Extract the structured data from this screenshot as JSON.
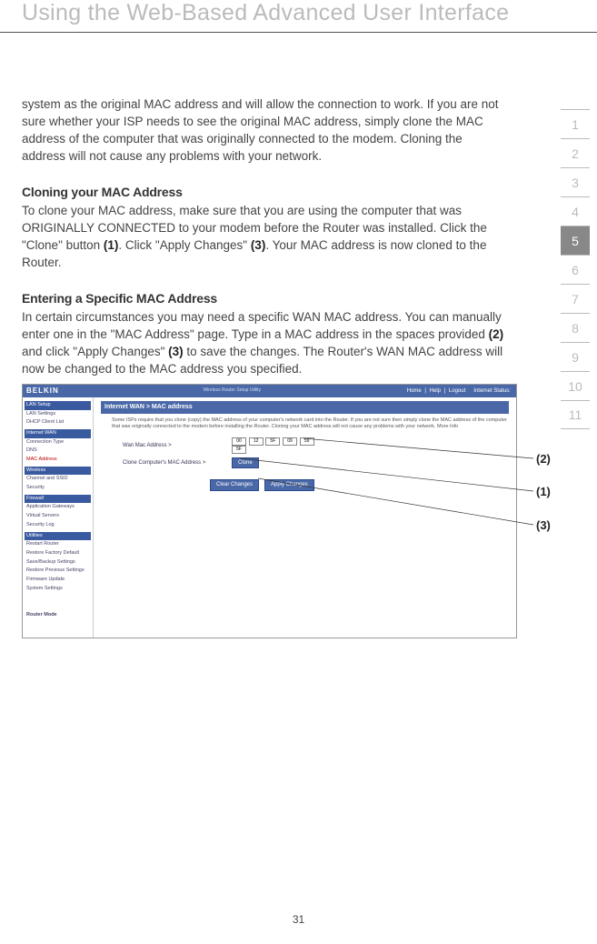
{
  "header": {
    "title": "Using the Web-Based Advanced User Interface"
  },
  "body": {
    "intro": "system as the original MAC address and will allow the connection to work. If you are not sure whether your ISP needs to see the original MAC address, simply clone the MAC address of the computer that was originally connected to the modem. Cloning the address will not cause any problems with your network.",
    "cloning_head": "Cloning your MAC Address",
    "cloning_p1a": "To clone your MAC address, make sure that you are using the computer that was ORIGINALLY CONNECTED to your modem before the Router was installed. Click the \"Clone\" button ",
    "ref1": "(1)",
    "cloning_p1b": ". Click \"Apply Changes\" ",
    "ref3a": "(3)",
    "cloning_p1c": ". Your MAC address is now cloned to the Router.",
    "entering_head": "Entering a Specific MAC Address",
    "entering_p1a": "In certain circumstances you may need a specific WAN MAC address. You can manually enter one in the \"MAC Address\" page. Type in a MAC address in the spaces provided ",
    "ref2": "(2)",
    "entering_p1b": " and click \"Apply Changes\" ",
    "ref3b": "(3)",
    "entering_p1c": " to save the changes. The Router's WAN MAC address will now be changed to the MAC address you specified."
  },
  "tabs": [
    "1",
    "2",
    "3",
    "4",
    "5",
    "6",
    "7",
    "8",
    "9",
    "10",
    "11"
  ],
  "active_tab": "5",
  "screenshot": {
    "brand": "BELKIN",
    "subtitle": "Wireless Router Setup Utility",
    "toplinks": [
      "Home",
      "Help",
      "Logout",
      "Internet Status:"
    ],
    "breadcrumb": "Internet WAN > MAC address",
    "desc": "Some ISPs require that you clone (copy) the MAC address of your computer's network card into the Router. If you are not sure then simply clone the MAC address of the computer that was originally connected to the modem before installing the Router. Cloning your MAC address will not cause any problems with your network. More Info",
    "row1_label": "Wan Mac Address >",
    "mac": [
      "00",
      "12",
      "5F",
      "09",
      "59",
      ""
    ],
    "mac2": [
      "5F",
      "",
      "",
      "",
      "",
      ""
    ],
    "row2_label": "Clone Computer's MAC Address >",
    "clone_btn": "Clone",
    "clear_btn": "Clear Changes",
    "apply_btn": "Apply Changes",
    "sidebar": {
      "groups": [
        {
          "head": "LAN Setup",
          "items": [
            "LAN Settings",
            "DHCP Client List"
          ]
        },
        {
          "head": "Internet WAN",
          "items": [
            "Connection Type",
            "DNS"
          ],
          "red": "MAC Address"
        },
        {
          "head": "Wireless",
          "items": [
            "Channel and SSID",
            "Security"
          ]
        },
        {
          "head": "Firewall",
          "items": [
            "Application Gateways",
            "Virtual Servers",
            "Security Log"
          ]
        },
        {
          "head": "Utilities",
          "items": [
            "Restart Router",
            "Restore Factory Default",
            "Save/Backup Settings",
            "Restore Previous Settings",
            "Firmware Update",
            "System Settings"
          ]
        }
      ],
      "footer": "Router Mode"
    }
  },
  "callouts": {
    "c1": "(1)",
    "c2": "(2)",
    "c3": "(3)"
  },
  "page_number": "31"
}
